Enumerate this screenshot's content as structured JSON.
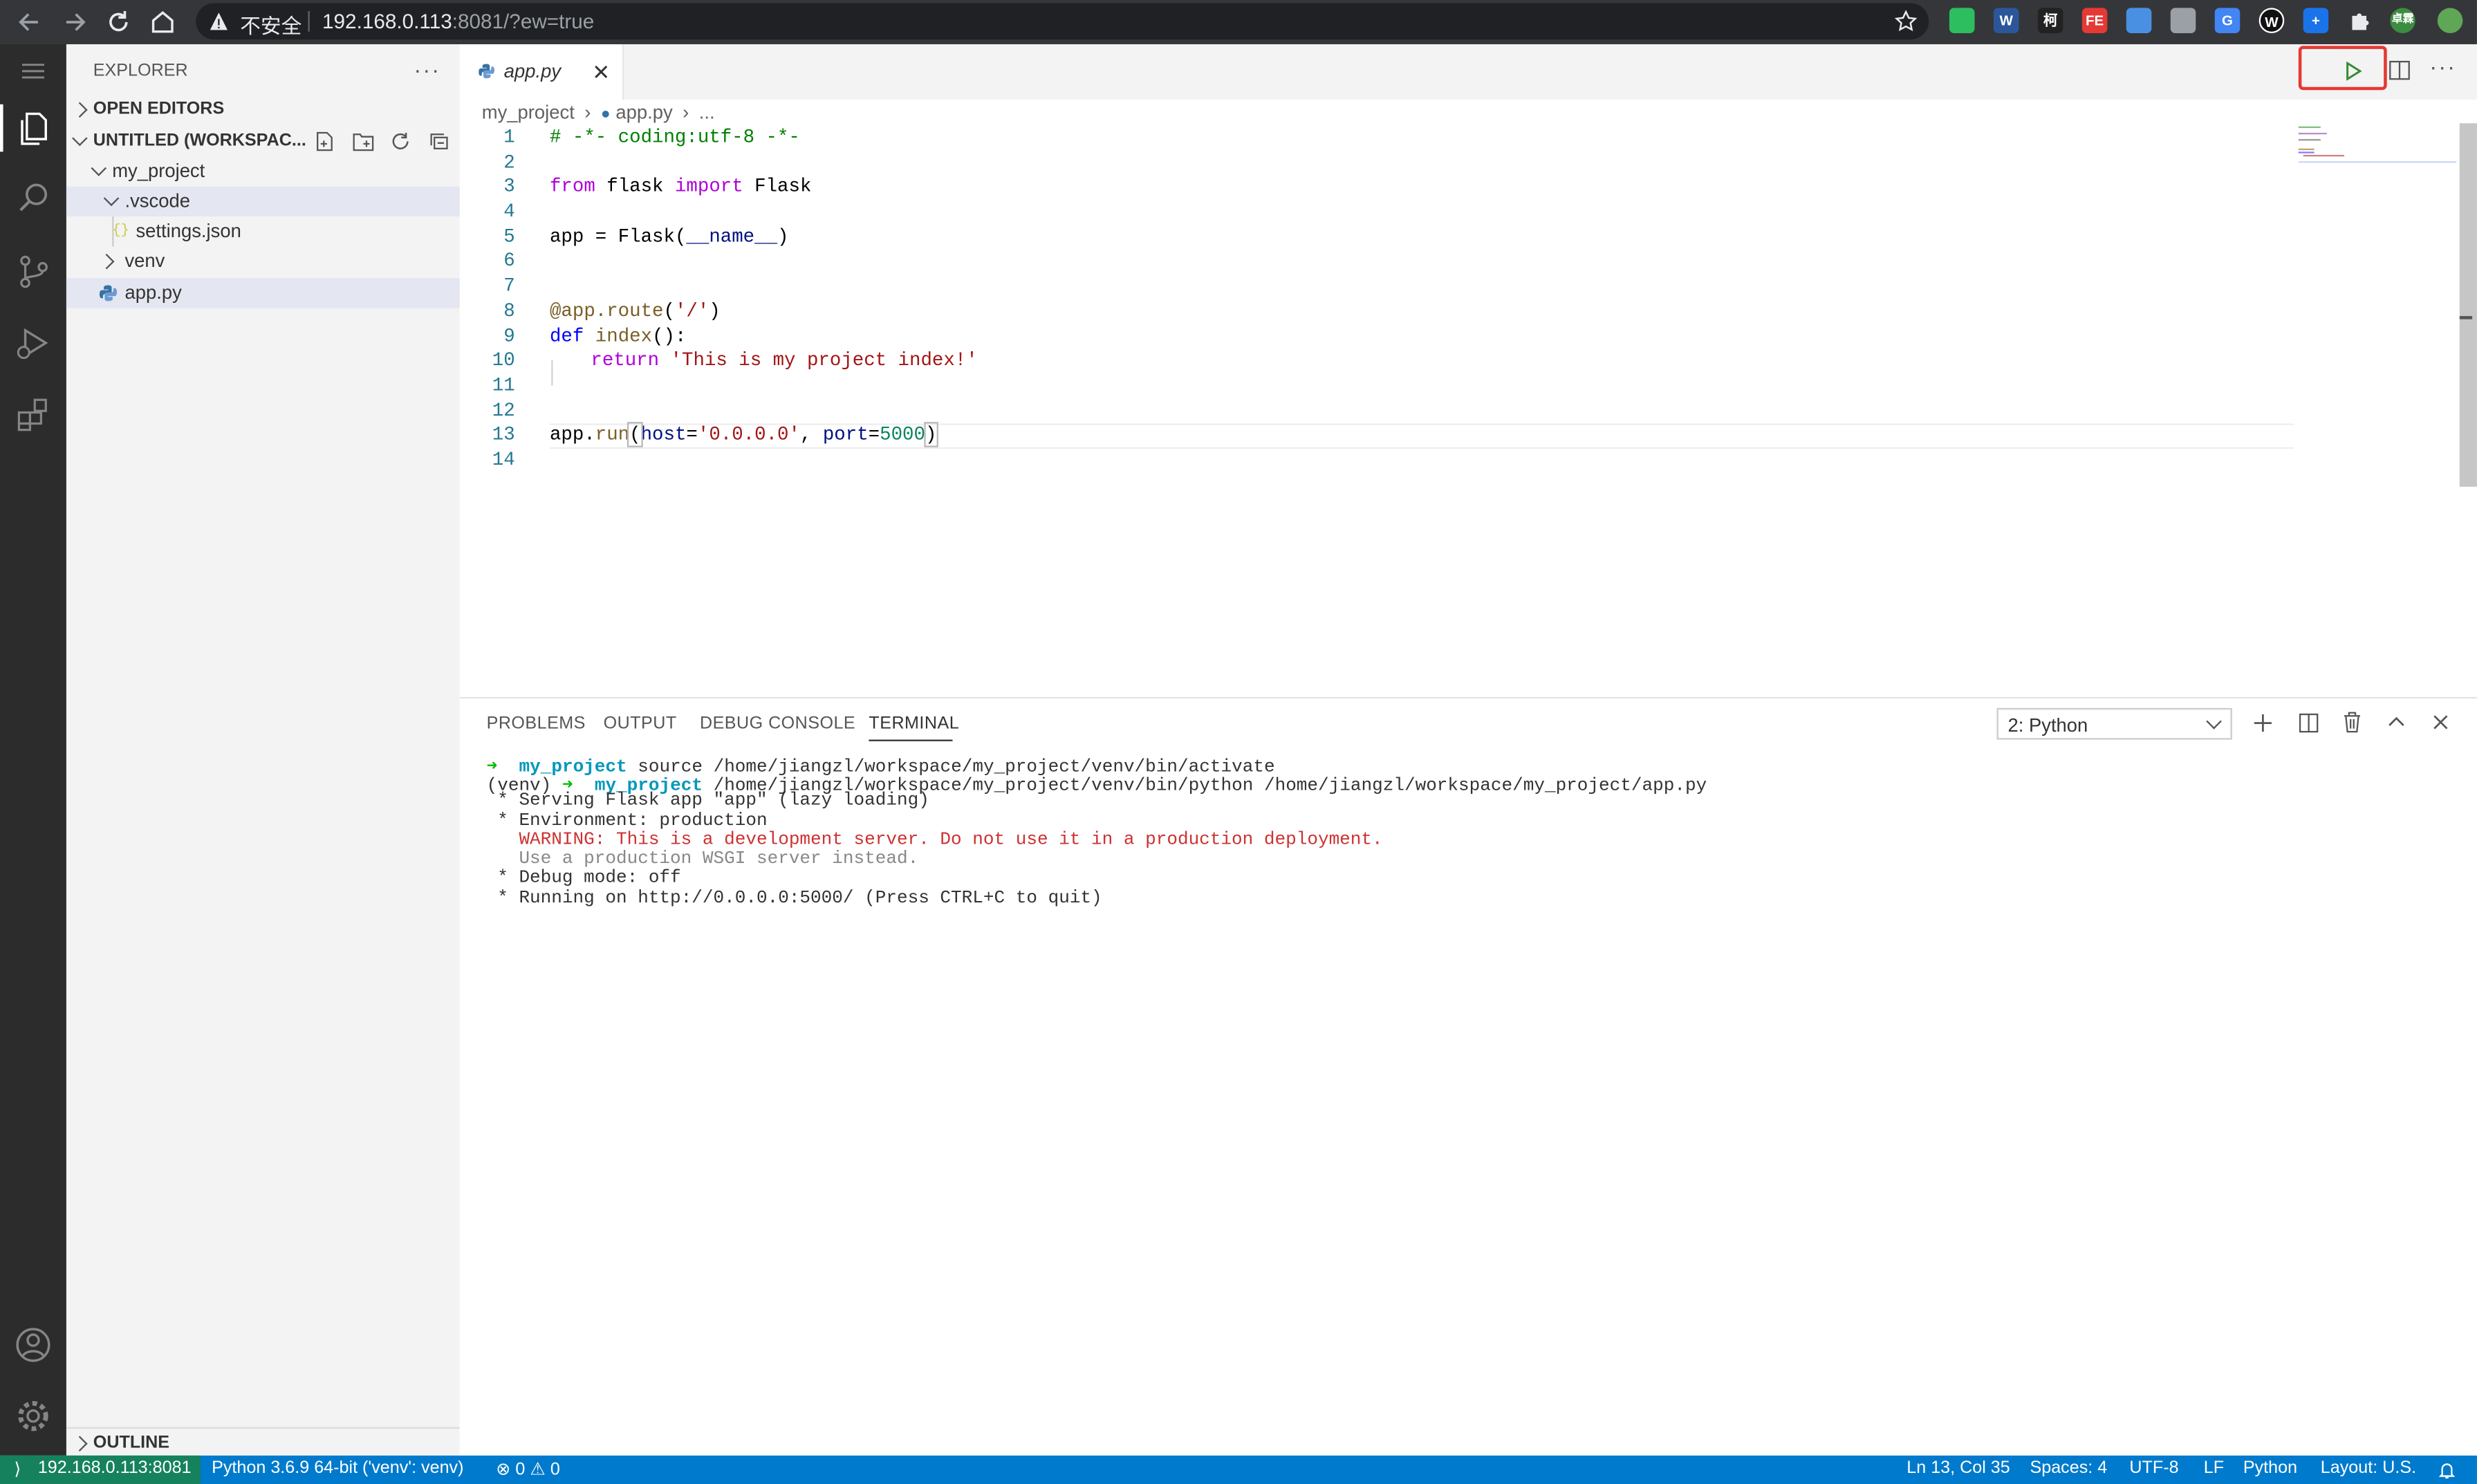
{
  "browser": {
    "security_label": "不安全",
    "url_host": "192.168.0.113",
    "url_rest": ":8081/?ew=true",
    "extensions": [
      {
        "name": "evernote-icon",
        "label": "",
        "color": "#2dbe60"
      },
      {
        "name": "word-icon",
        "label": "W",
        "color": "#2b579a"
      },
      {
        "name": "ke-icon",
        "label": "柯",
        "color": "#222222"
      },
      {
        "name": "fe-icon",
        "label": "FE",
        "color": "#e53935"
      },
      {
        "name": "diamond-icon",
        "label": "",
        "color": "#4a90e2"
      },
      {
        "name": "vue-icon",
        "label": "",
        "color": "#9aa0a6"
      },
      {
        "name": "translate-icon",
        "label": "G",
        "color": "#4285f4"
      },
      {
        "name": "w-circle-icon",
        "label": "W",
        "color": "#111111"
      },
      {
        "name": "plus-extension-icon",
        "label": "+",
        "color": "#1a73e8"
      },
      {
        "name": "puzzle-icon",
        "label": "",
        "color": "#35363a"
      },
      {
        "name": "avatar",
        "label": "卓霖",
        "color": "#3c8d40"
      },
      {
        "name": "update-icon",
        "label": "",
        "color": "#5fa657"
      }
    ]
  },
  "explorer": {
    "title": "EXPLORER",
    "open_editors": "OPEN EDITORS",
    "workspace": "UNTITLED (WORKSPAC...",
    "tree": [
      {
        "label": "my_project"
      },
      {
        "label": ".vscode"
      },
      {
        "label": "settings.json",
        "icon": "{}"
      },
      {
        "label": "venv"
      },
      {
        "label": "app.py"
      }
    ],
    "outline": "OUTLINE"
  },
  "editor": {
    "tab_label": "app.py",
    "breadcrumb": {
      "folder": "my_project",
      "file": "app.py",
      "more": "..."
    },
    "line_numbers": [
      "1",
      "2",
      "3",
      "4",
      "5",
      "6",
      "7",
      "8",
      "9",
      "10",
      "11",
      "12",
      "13",
      "14"
    ],
    "code": {
      "l1": "# -*- coding:utf-8 -*-",
      "l3a": "from",
      "l3b": " flask ",
      "l3c": "import",
      "l3d": " Flask",
      "l5a": "app = ",
      "l5b": "Flask",
      "l5c": "(",
      "l5d": "__name__",
      "l5e": ")",
      "l8a": "@app.route",
      "l8b": "(",
      "l8c": "'/'",
      "l8d": ")",
      "l9a": "def",
      "l9b": " ",
      "l9c": "index",
      "l9d": "():",
      "l10a": "return",
      "l10b": " ",
      "l10c": "'This is my project index!'",
      "l13a": "app.",
      "l13b": "run",
      "l13c": "(",
      "l13d": "host",
      "l13e": "=",
      "l13f": "'0.0.0.0'",
      "l13g": ", ",
      "l13h": "port",
      "l13i": "=",
      "l13j": "5000",
      "l13k": ")"
    }
  },
  "panel": {
    "tabs": [
      "PROBLEMS",
      "OUTPUT",
      "DEBUG CONSOLE",
      "TERMINAL"
    ],
    "terminal_select": "2: Python",
    "terminal": {
      "l1_prompt": "➜",
      "l1_dir": "my_project",
      "l1_cmd": " source /home/jiangzl/workspace/my_project/venv/bin/activate",
      "l2_venv": "(venv) ",
      "l2_prompt": "➜",
      "l2_dir": "my_project",
      "l2_cmd": " /home/jiangzl/workspace/my_project/venv/bin/python /home/jiangzl/workspace/my_project/app.py",
      "l3": " * Serving Flask app \"app\" (lazy loading)",
      "l4": " * Environment: production",
      "l5": "   WARNING: This is a development server. Do not use it in a production deployment.",
      "l6": "   Use a production WSGI server instead.",
      "l7": " * Debug mode: off",
      "l8": " * Running on http://0.0.0.0:5000/ (Press CTRL+C to quit)"
    }
  },
  "status": {
    "remote": "192.168.0.113:8081",
    "interpreter": "Python 3.6.9 64-bit ('venv': venv)",
    "errors": "0",
    "warnings": "0",
    "position": "Ln 13, Col 35",
    "spaces": "Spaces: 4",
    "encoding": "UTF-8",
    "eol": "LF",
    "language": "Python",
    "layout": "Layout: U.S."
  },
  "colors": {
    "status_bar": "#007acc",
    "remote_badge": "#16825d",
    "highlight_box": "#e53935",
    "run_icon": "#388a34"
  }
}
